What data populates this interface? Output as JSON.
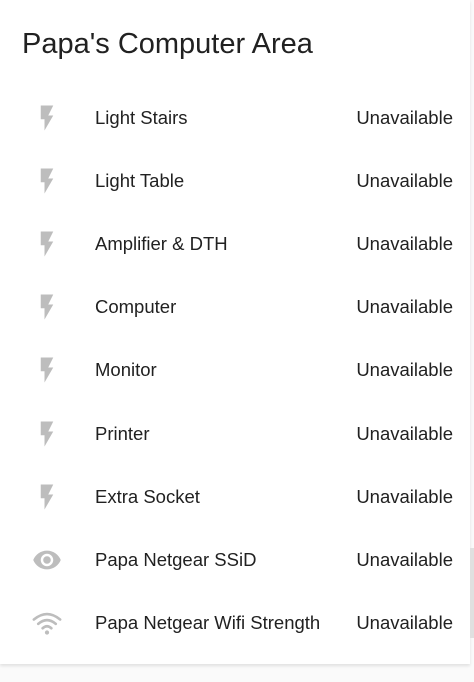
{
  "card": {
    "title": "Papa's Computer Area"
  },
  "colors": {
    "icon": "#bdbdbd",
    "text": "#212121",
    "card_background": "#ffffff"
  },
  "entities": [
    {
      "icon": "lightning-bolt-icon",
      "name": "Light Stairs",
      "state": "Unavailable"
    },
    {
      "icon": "lightning-bolt-icon",
      "name": "Light Table",
      "state": "Unavailable"
    },
    {
      "icon": "lightning-bolt-icon",
      "name": "Amplifier & DTH",
      "state": "Unavailable"
    },
    {
      "icon": "lightning-bolt-icon",
      "name": "Computer",
      "state": "Unavailable"
    },
    {
      "icon": "lightning-bolt-icon",
      "name": "Monitor",
      "state": "Unavailable"
    },
    {
      "icon": "lightning-bolt-icon",
      "name": "Printer",
      "state": "Unavailable"
    },
    {
      "icon": "lightning-bolt-icon",
      "name": "Extra Socket",
      "state": "Unavailable"
    },
    {
      "icon": "eye-icon",
      "name": "Papa Netgear SSiD",
      "state": "Unavailable"
    },
    {
      "icon": "wifi-icon",
      "name": "Papa Netgear Wifi Strength",
      "state": "Unavailable"
    }
  ]
}
